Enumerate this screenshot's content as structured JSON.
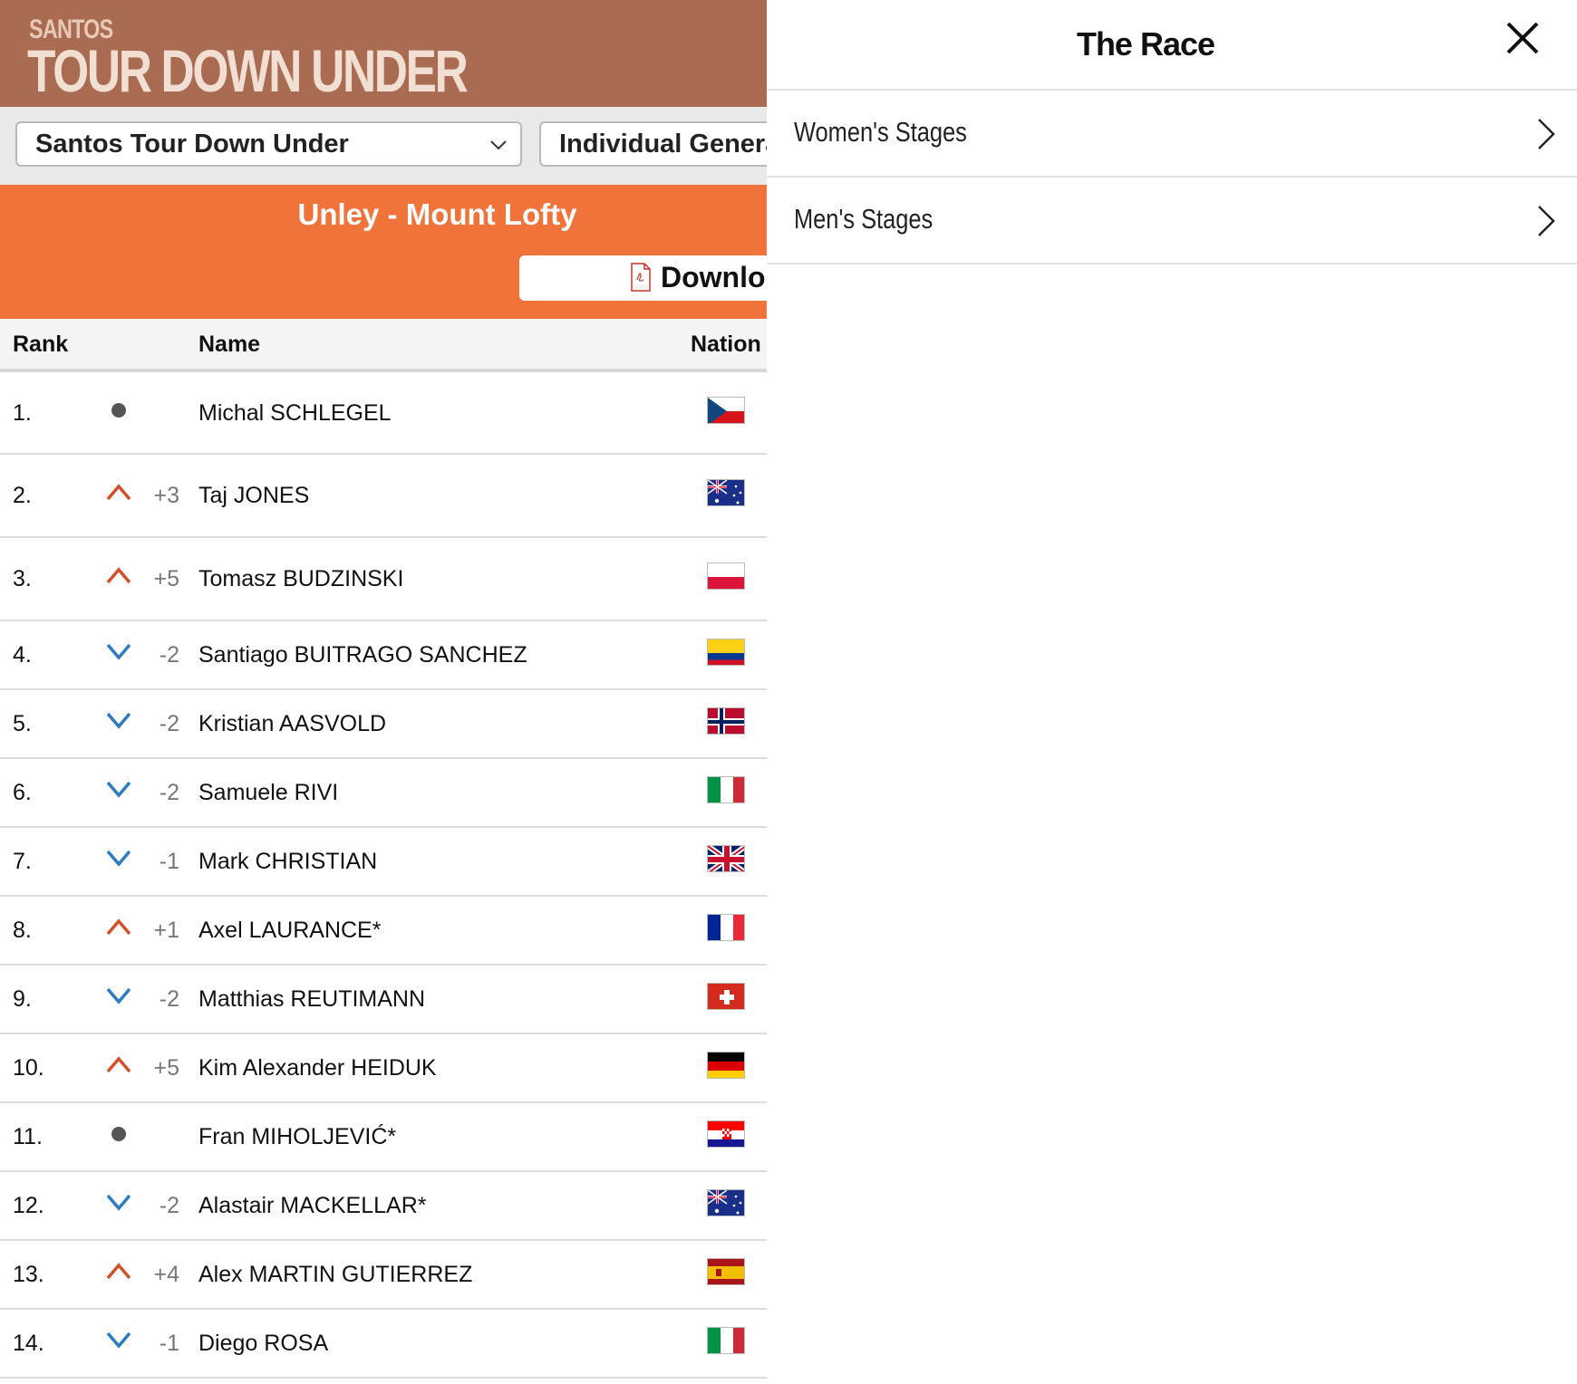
{
  "header": {
    "logo_small": "SANTOS",
    "logo_big": "TOUR DOWN UNDER"
  },
  "filters": {
    "race": "Santos Tour Down Under",
    "classification": "Individual Genera"
  },
  "stage": {
    "title": "Unley - Mount Lofty",
    "download_label": "Downlo"
  },
  "table": {
    "headers": {
      "rank": "Rank",
      "name": "Name",
      "nation": "Nation"
    },
    "rows": [
      {
        "rank": "1.",
        "move": "same",
        "delta": "",
        "name": "Michal SCHLEGEL",
        "flag": "cz"
      },
      {
        "rank": "2.",
        "move": "up",
        "delta": "+3",
        "name": "Taj JONES",
        "flag": "au"
      },
      {
        "rank": "3.",
        "move": "up",
        "delta": "+5",
        "name": "Tomasz BUDZINSKI",
        "flag": "pl"
      },
      {
        "rank": "4.",
        "move": "down",
        "delta": "-2",
        "name": "Santiago BUITRAGO SANCHEZ",
        "flag": "co"
      },
      {
        "rank": "5.",
        "move": "down",
        "delta": "-2",
        "name": "Kristian AASVOLD",
        "flag": "no"
      },
      {
        "rank": "6.",
        "move": "down",
        "delta": "-2",
        "name": "Samuele RIVI",
        "flag": "it"
      },
      {
        "rank": "7.",
        "move": "down",
        "delta": "-1",
        "name": "Mark CHRISTIAN",
        "flag": "gb"
      },
      {
        "rank": "8.",
        "move": "up",
        "delta": "+1",
        "name": "Axel LAURANCE*",
        "flag": "fr"
      },
      {
        "rank": "9.",
        "move": "down",
        "delta": "-2",
        "name": "Matthias REUTIMANN",
        "flag": "ch"
      },
      {
        "rank": "10.",
        "move": "up",
        "delta": "+5",
        "name": "Kim Alexander HEIDUK",
        "flag": "de"
      },
      {
        "rank": "11.",
        "move": "same",
        "delta": "",
        "name": "Fran MIHOLJEVIĆ*",
        "flag": "hr"
      },
      {
        "rank": "12.",
        "move": "down",
        "delta": "-2",
        "name": "Alastair MACKELLAR*",
        "flag": "au"
      },
      {
        "rank": "13.",
        "move": "up",
        "delta": "+4",
        "name": "Alex MARTIN GUTIERREZ",
        "flag": "es"
      },
      {
        "rank": "14.",
        "move": "down",
        "delta": "-1",
        "name": "Diego ROSA",
        "flag": "it"
      }
    ]
  },
  "panel": {
    "title": "The Race",
    "items": [
      {
        "label": "Women's Stages"
      },
      {
        "label": "Men's Stages"
      }
    ]
  },
  "colors": {
    "header_brown": "#a96b51",
    "stage_orange": "#f07339",
    "up_arrow": "#d2502a",
    "down_arrow": "#2e7cc0",
    "same_dot": "#555555"
  }
}
